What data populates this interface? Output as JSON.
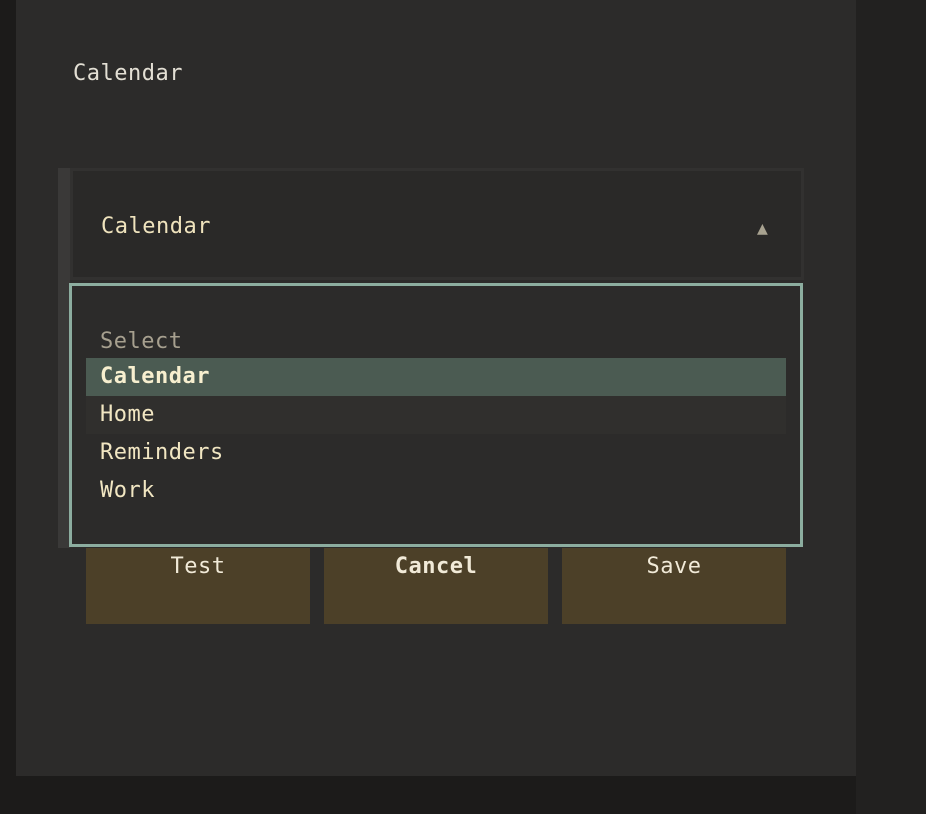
{
  "form": {
    "field_label": "Calendar"
  },
  "select": {
    "value": "Calendar",
    "arrow_icon": "triangle-up-icon",
    "options": [
      {
        "label": "Select",
        "state": "placeholder"
      },
      {
        "label": "Calendar",
        "state": "selected"
      },
      {
        "label": "Home",
        "state": "hover"
      },
      {
        "label": "Reminders",
        "state": "normal"
      },
      {
        "label": "Work",
        "state": "normal"
      }
    ]
  },
  "buttons": {
    "test": "Test",
    "cancel": "Cancel",
    "save": "Save"
  },
  "colors": {
    "background": "#1c1b1a",
    "panel": "#2c2b2a",
    "accent_border": "#8cad9f",
    "selected_option": "#4b5b52",
    "button": "#4c4028",
    "text": "#f1e6c2"
  }
}
